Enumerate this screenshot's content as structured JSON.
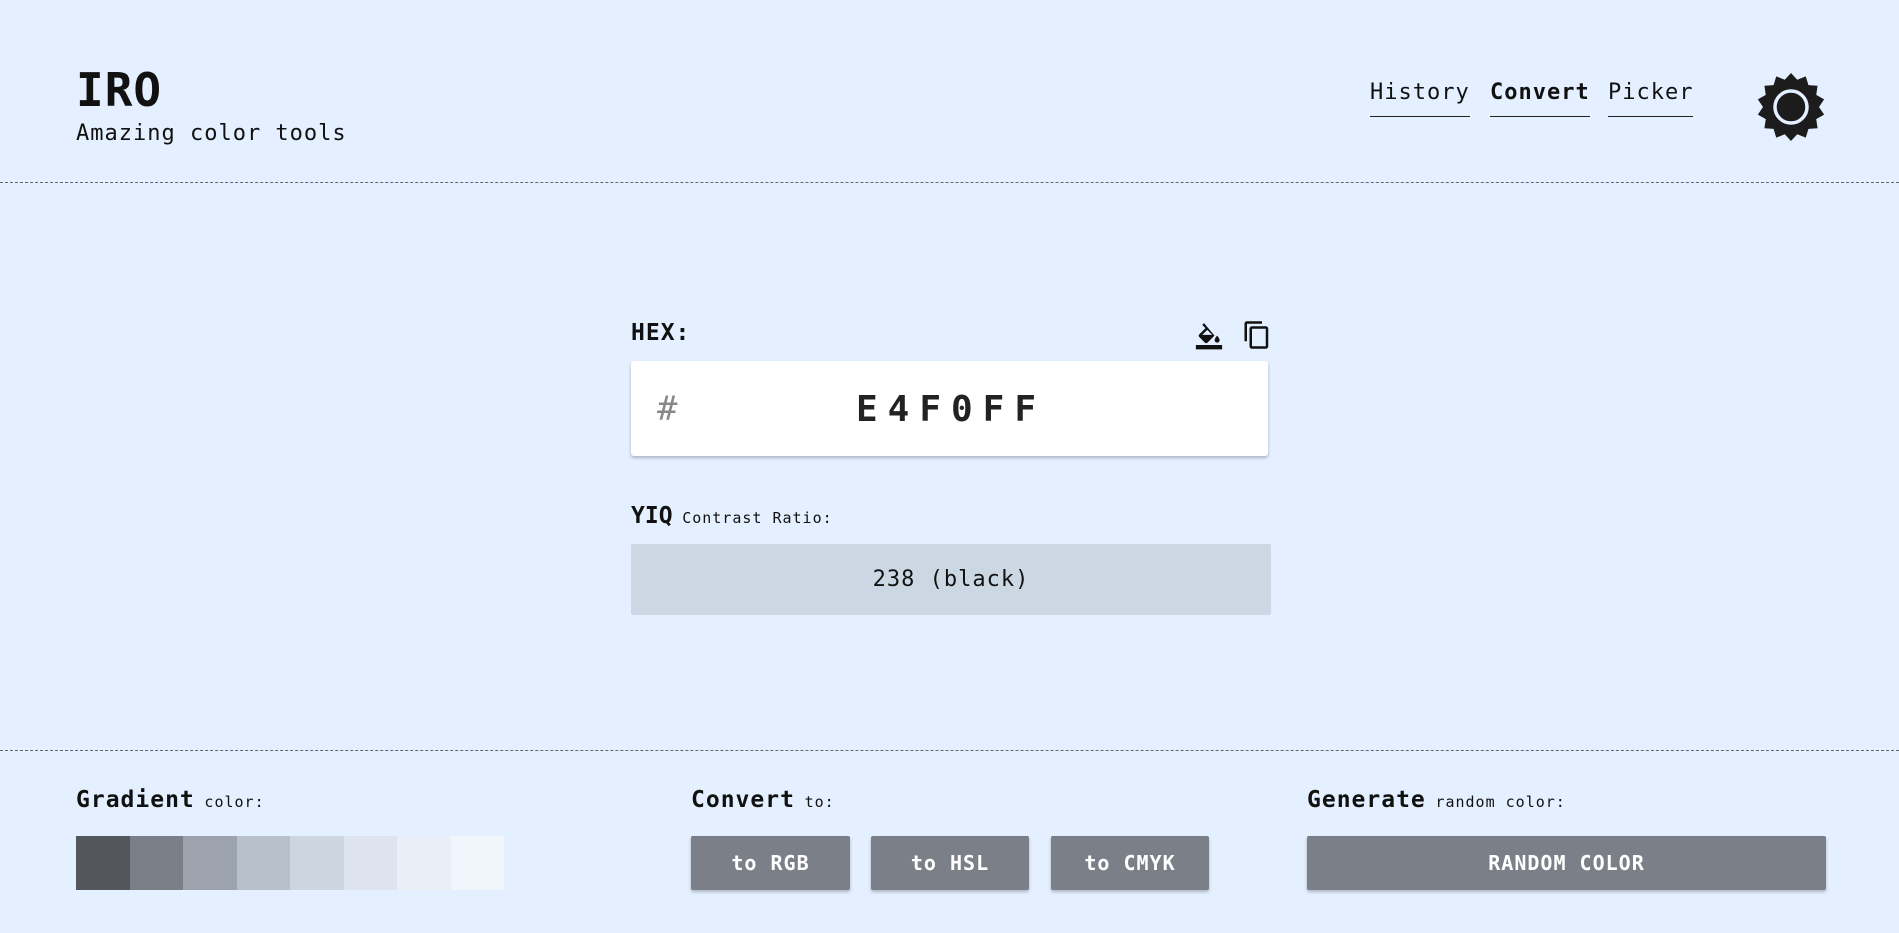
{
  "header": {
    "title": "IRO",
    "subtitle": "Amazing color tools",
    "nav": [
      {
        "label": "History",
        "active": false
      },
      {
        "label": "Convert",
        "active": true
      },
      {
        "label": "Picker",
        "active": false
      }
    ],
    "theme_icon": "sun-icon"
  },
  "converter": {
    "hex_label": "HEX:",
    "hex_prefix": "#",
    "hex_value": "E4F0FF",
    "icons": [
      "fill-color-icon",
      "copy-icon"
    ],
    "yiq_title": "YIQ",
    "yiq_note": "Contrast Ratio:",
    "yiq_value": "238 (black)"
  },
  "footer": {
    "gradient": {
      "title": "Gradient",
      "note": "color:",
      "swatches": [
        "#53575c",
        "#7b8088",
        "#9ca3ac",
        "#b8c0ca",
        "#cdd5df",
        "#dde4ee",
        "#e9eef7",
        "#f1f5fc"
      ]
    },
    "convert": {
      "title": "Convert",
      "note": "to:",
      "buttons": [
        "to RGB",
        "to HSL",
        "to CMYK"
      ]
    },
    "generate": {
      "title": "Generate",
      "note": "random color:",
      "button": "RANDOM COLOR"
    }
  },
  "colors": {
    "background": "#e4f0ff",
    "button": "#7b8088",
    "yiq_box": "#cbd8e4"
  }
}
